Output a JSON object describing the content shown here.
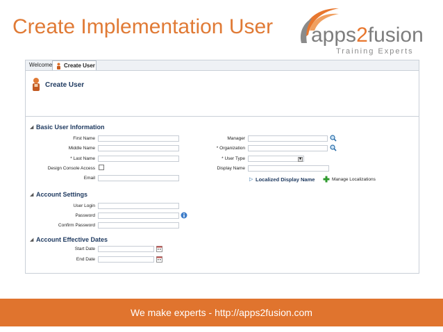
{
  "slide": {
    "title": "Create Implementation User",
    "footer": "We make experts - http://apps2fusion.com"
  },
  "logo": {
    "word_prefix": "apps",
    "word_number": "2",
    "word_suffix": "fusion",
    "tagline": "Training Experts",
    "accent_color": "#e8772e"
  },
  "tabs": [
    {
      "label": "Welcome"
    },
    {
      "label": "Create User"
    }
  ],
  "page": {
    "title": "Create User"
  },
  "basic": {
    "title": "Basic User Information",
    "first_name": "First Name",
    "middle_name": "Middle Name",
    "last_name": "* Last Name",
    "design_console": "Design Console Access",
    "email": "Email",
    "manager": "Manager",
    "organization": "* Organization",
    "user_type": "* User Type",
    "display_name": "Display Name",
    "localized": "Localized Display Name",
    "manage_localizations": "Manage Localizations"
  },
  "account": {
    "title": "Account Settings",
    "user_login": "User Login",
    "password": "Password",
    "confirm_password": "Confirm Password"
  },
  "dates": {
    "title": "Account Effective Dates",
    "start_date": "Start Date",
    "end_date": "End Date"
  },
  "icons": {
    "search": "search-icon",
    "info": "info-icon",
    "calendar": "calendar-icon",
    "add": "add-icon",
    "user": "user-icon"
  }
}
